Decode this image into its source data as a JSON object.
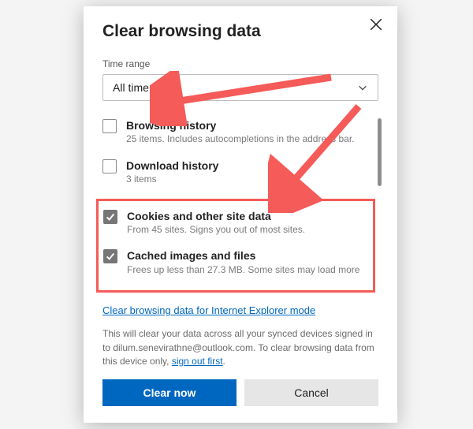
{
  "dialog": {
    "title": "Clear browsing data",
    "timeRangeLabel": "Time range",
    "timeRangeValue": "All time",
    "items": [
      {
        "checked": false,
        "title": "Browsing history",
        "sub": "25 items. Includes autocompletions in the address bar."
      },
      {
        "checked": false,
        "title": "Download history",
        "sub": "3 items"
      },
      {
        "checked": true,
        "title": "Cookies and other site data",
        "sub": "From 45 sites. Signs you out of most sites."
      },
      {
        "checked": true,
        "title": "Cached images and files",
        "sub": "Frees up less than 27.3 MB. Some sites may load more"
      }
    ],
    "ieLink": "Clear browsing data for Internet Explorer mode",
    "footerPrefix": "This will clear your data across all your synced devices signed in to ",
    "footerEmail": "dilum.senevirathne@outlook.com",
    "footerMid": ". To clear browsing data from this device only, ",
    "footerLink": "sign out first",
    "footerSuffix": ".",
    "clearNow": "Clear now",
    "cancel": "Cancel"
  }
}
